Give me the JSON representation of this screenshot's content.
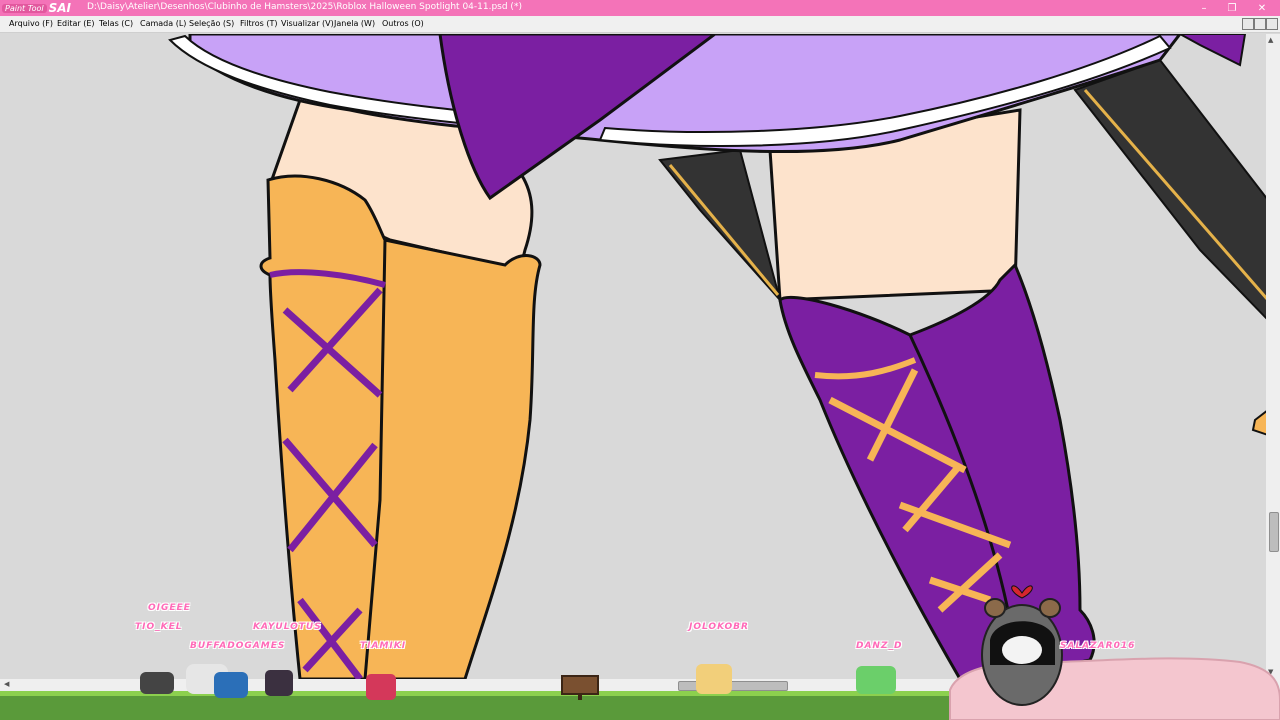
{
  "window": {
    "app_logo_small": "Paint Tool",
    "app_logo": "SAI",
    "title": "D:\\Daisy\\Atelier\\Desenhos\\Clubinho de Hamsters\\2025\\Roblox Halloween Spotlight 04-11.psd (*)",
    "minimize": "–",
    "restore": "❐",
    "close": "✕"
  },
  "menu": {
    "items": [
      {
        "label": "Arquivo (F)"
      },
      {
        "label": "Editar (E)"
      },
      {
        "label": "Telas (C)"
      },
      {
        "label": "Camada (L)"
      },
      {
        "label": "Seleção (S)"
      },
      {
        "label": "Filtros (T)"
      },
      {
        "label": "Visualizar (V)"
      },
      {
        "label": "Janela (W)"
      },
      {
        "label": "Outros (O)"
      }
    ]
  },
  "stream_overlay": {
    "viewers": [
      {
        "name": "OIGEEE"
      },
      {
        "name": "TIO_KEL"
      },
      {
        "name": "BUFFADOGAMES"
      },
      {
        "name": "KAYULOTUS"
      },
      {
        "name": "TIAMIKI"
      },
      {
        "name": "JOLOKOBR"
      },
      {
        "name": "DANZ_D"
      },
      {
        "name": "SALAZAR016"
      }
    ]
  },
  "colors": {
    "titlebar": "#f473b8",
    "canvas_bg": "#d9d9d9",
    "boot_orange": "#f7b556",
    "boot_purple": "#7b1fa2",
    "skirt_lilac": "#c8a2f7",
    "skin": "#fde3cc"
  }
}
